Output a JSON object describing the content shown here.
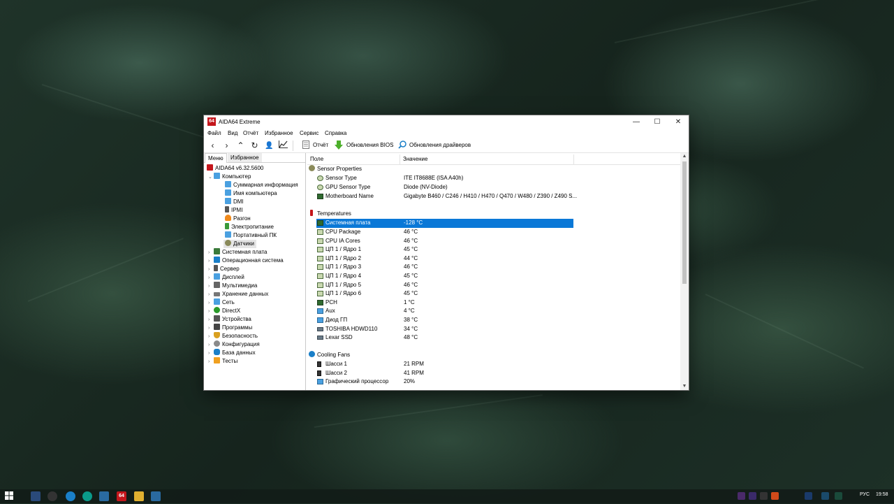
{
  "window": {
    "app_icon": "64",
    "title": "AIDA64 Extreme",
    "minimize_glyph": "—",
    "maximize_glyph": "☐",
    "close_glyph": "✕"
  },
  "menu": [
    "Файл",
    "Вид",
    "Отчёт",
    "Избранное",
    "Сервис",
    "Справка"
  ],
  "toolbar": {
    "back_icon": "chevron-left-icon",
    "forward_icon": "chevron-right-icon",
    "up_icon": "chevron-up-icon",
    "refresh_icon": "refresh-icon",
    "user_icon": "user-icon",
    "chart_icon": "chart-line-icon",
    "report_label": "Отчёт",
    "bios_label": "Обновления BIOS",
    "drivers_label": "Обновления драйверов"
  },
  "left_tabs": {
    "menu": "Меню",
    "favorites": "Избранное"
  },
  "tree": {
    "root": "AIDA64 v6.32.5600",
    "computer": "Компьютер",
    "computer_children": [
      "Суммарная информация",
      "Имя компьютера",
      "DMI",
      "IPMI",
      "Разгон",
      "Электропитание",
      "Портативный ПК",
      "Датчики"
    ],
    "top_items": [
      "Системная плата",
      "Операционная система",
      "Сервер",
      "Дисплей",
      "Мультимедиа",
      "Хранение данных",
      "Сеть",
      "DirectX",
      "Устройства",
      "Программы",
      "Безопасность",
      "Конфигурация",
      "База данных",
      "Тесты"
    ]
  },
  "columns": {
    "field": "Поле",
    "value": "Значение"
  },
  "sections": {
    "sensor_properties": {
      "title": "Sensor Properties",
      "rows": [
        {
          "field": "Sensor Type",
          "value": "ITE IT8688E  (ISA A40h)"
        },
        {
          "field": "GPU Sensor Type",
          "value": "Diode  (NV-Diode)"
        },
        {
          "field": "Motherboard Name",
          "value": "Gigabyte B460 / C246 / H410 / H470 / Q470 / W480 / Z390 / Z490 S..."
        }
      ]
    },
    "temperatures": {
      "title": "Temperatures",
      "rows": [
        {
          "field": "Системная плата",
          "value": "-128 °C",
          "selected": true
        },
        {
          "field": "CPU Package",
          "value": "46 °C"
        },
        {
          "field": "CPU IA Cores",
          "value": "46 °C"
        },
        {
          "field": "ЦП 1 / Ядро 1",
          "value": "45 °C"
        },
        {
          "field": "ЦП 1 / Ядро 2",
          "value": "44 °C"
        },
        {
          "field": "ЦП 1 / Ядро 3",
          "value": "46 °C"
        },
        {
          "field": "ЦП 1 / Ядро 4",
          "value": "45 °C"
        },
        {
          "field": "ЦП 1 / Ядро 5",
          "value": "46 °C"
        },
        {
          "field": "ЦП 1 / Ядро 6",
          "value": "45 °C"
        },
        {
          "field": "PCH",
          "value": "1 °C"
        },
        {
          "field": "Aux",
          "value": "4 °C"
        },
        {
          "field": "Диод ГП",
          "value": "38 °C"
        },
        {
          "field": "TOSHIBA HDWD110",
          "value": "34 °C"
        },
        {
          "field": "Lexar SSD",
          "value": "48 °C"
        }
      ]
    },
    "cooling_fans": {
      "title": "Cooling Fans",
      "rows": [
        {
          "field": "Шасси 1",
          "value": "21 RPM"
        },
        {
          "field": "Шасси 2",
          "value": "41 RPM"
        },
        {
          "field": "Графический процессор",
          "value": "20%"
        }
      ]
    }
  },
  "taskbar": {
    "start_icon": "windows-start-icon",
    "aida_icon": "64",
    "tray": {
      "lang": "РУС",
      "time": "19:58"
    }
  },
  "colors": {
    "selection": "#0a78d7",
    "app_red": "#c4161c"
  }
}
